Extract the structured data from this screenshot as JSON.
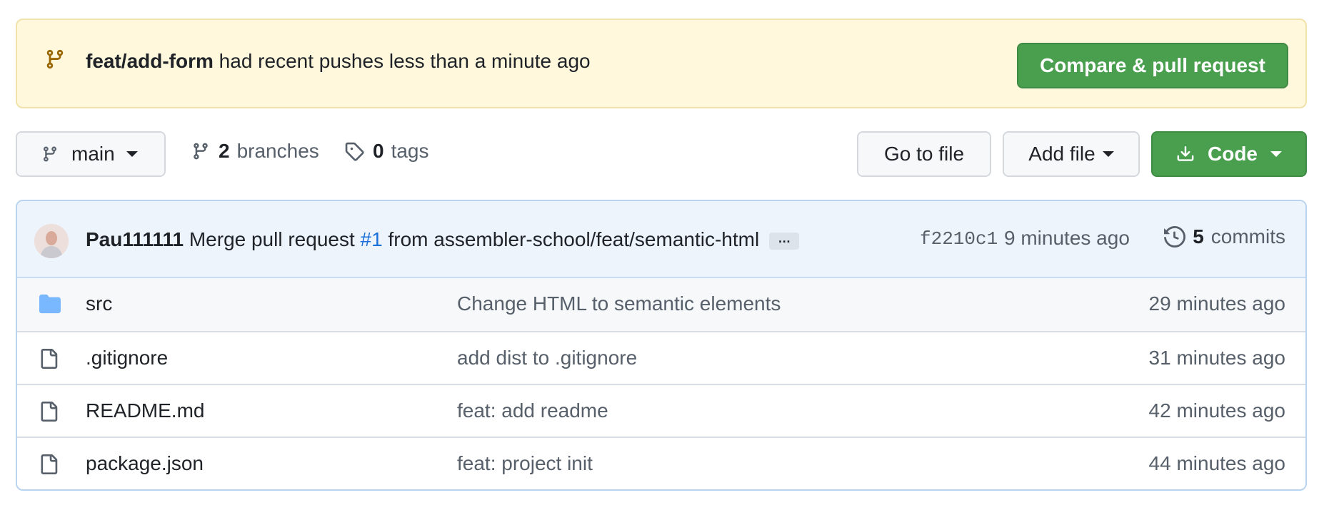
{
  "banner": {
    "branch": "feat/add-form",
    "text": " had recent pushes less than a minute ago",
    "compare_label": "Compare & pull request"
  },
  "toolbar": {
    "branch_label": "main",
    "branches_count": "2",
    "branches_label": "branches",
    "tags_count": "0",
    "tags_label": "tags",
    "go_to_file_label": "Go to file",
    "add_file_label": "Add file",
    "code_label": "Code"
  },
  "commit": {
    "author": "Pau111111",
    "message_prefix": " Merge pull request ",
    "pr_link": "#1",
    "message_suffix": " from assembler-school/feat/semantic-html",
    "ellipsis": "…",
    "sha": "f2210c1",
    "time": "9 minutes ago",
    "commits_count": "5",
    "commits_label": "commits"
  },
  "files": [
    {
      "name": "src",
      "type": "folder",
      "message": "Change HTML to semantic elements",
      "time": "29 minutes ago"
    },
    {
      "name": ".gitignore",
      "type": "file",
      "message": "add dist to .gitignore",
      "time": "31 minutes ago"
    },
    {
      "name": "README.md",
      "type": "file",
      "message": "feat: add readme",
      "time": "42 minutes ago"
    },
    {
      "name": "package.json",
      "type": "file",
      "message": "feat: project init",
      "time": "44 minutes ago"
    }
  ],
  "colors": {
    "banner_bg": "#fff8dc",
    "primary_green": "#4a9f4f",
    "link_blue": "#1a6fd8",
    "folder_blue": "#79b8ff"
  },
  "icons": {
    "banner": "git-branch-icon",
    "branch_button": "git-branch-icon",
    "branches": "git-branch-icon",
    "tags": "tag-icon",
    "code": "download-icon",
    "commits": "history-icon",
    "folder": "folder-icon",
    "file": "file-icon"
  }
}
